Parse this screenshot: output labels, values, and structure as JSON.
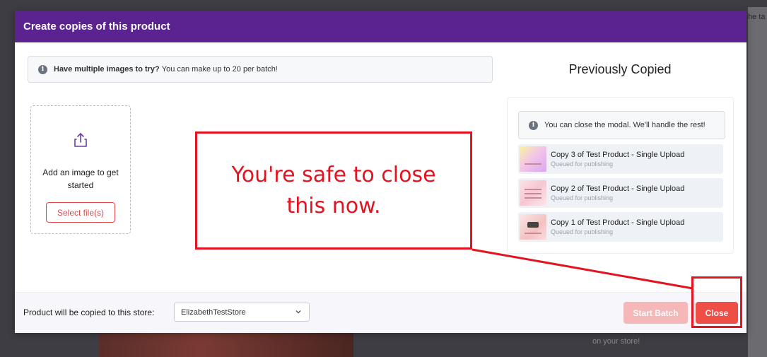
{
  "background": {
    "right_edge_text": "he ta",
    "bottom_text": "on your store!"
  },
  "modal": {
    "title": "Create copies of this product",
    "info_banner": {
      "strong": "Have multiple images to try?",
      "text": "You can make up to 20 per batch!"
    },
    "upload": {
      "icon": "upload-icon",
      "text": "Add an image to get started",
      "button": "Select file(s)"
    },
    "previously_copied": {
      "title": "Previously Copied",
      "note": "You can close the modal. We'll handle the rest!",
      "items": [
        {
          "name": "Copy 3 of Test Product - Single Upload",
          "status": "Queued for publishing"
        },
        {
          "name": "Copy 2 of Test Product - Single Upload",
          "status": "Queued for publishing"
        },
        {
          "name": "Copy 1 of Test Product - Single Upload",
          "status": "Queued for publishing"
        }
      ]
    },
    "footer": {
      "label": "Product will be copied to this store:",
      "store_value": "ElizabethTestStore",
      "start_batch": "Start Batch",
      "close": "Close"
    }
  },
  "annotation": {
    "text": "You're safe to close this now.",
    "color": "#e3141f"
  },
  "colors": {
    "header": "#5a2390",
    "primary": "#ef4e47",
    "primary_disabled": "#f5b7b7"
  }
}
